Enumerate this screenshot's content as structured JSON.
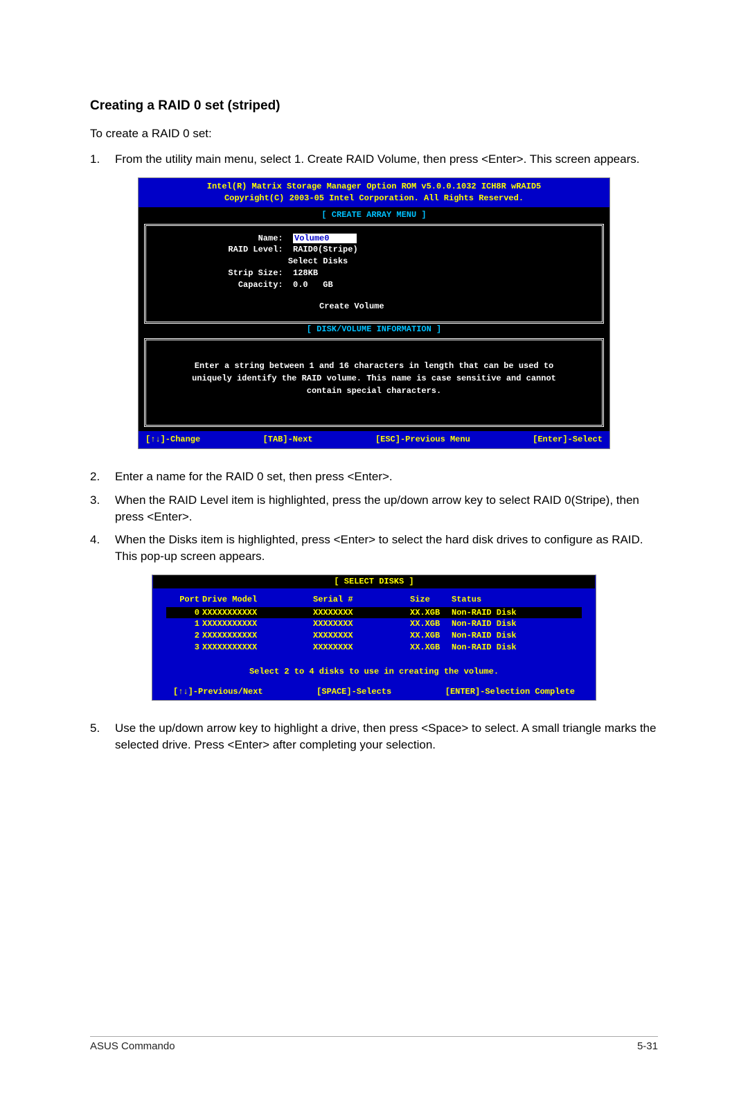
{
  "heading": "Creating a RAID 0 set (striped)",
  "intro": "To create a RAID 0 set:",
  "steps": {
    "s1": {
      "num": "1.",
      "text": "From the utility main menu, select 1. Create RAID Volume, then press <Enter>. This screen appears."
    },
    "s2": {
      "num": "2.",
      "text": "Enter a name for the RAID 0 set, then press <Enter>."
    },
    "s3": {
      "num": "3.",
      "text": "When the RAID Level item is highlighted, press the up/down arrow key to select RAID 0(Stripe), then press <Enter>."
    },
    "s4": {
      "num": "4.",
      "text": "When the Disks item is highlighted, press <Enter> to select the hard disk drives to configure as RAID. This pop-up screen appears."
    },
    "s5": {
      "num": "5.",
      "text": "Use the up/down arrow key to highlight a drive, then press <Space>  to select. A small triangle marks the selected drive. Press <Enter> after completing your selection."
    }
  },
  "bios1": {
    "header_line1": "Intel(R) Matrix Storage Manager Option ROM v5.0.0.1032 ICH8R wRAID5",
    "header_line2": "Copyright(C) 2003-05 Intel Corporation. All Rights Reserved.",
    "menu_title": "[ CREATE ARRAY MENU ]",
    "fields": {
      "name_label": "Name:",
      "name_value": "Volume0",
      "raid_label": "RAID Level:",
      "raid_value": "RAID0(Stripe)",
      "select_disks": "Select Disks",
      "strip_label": "Strip Size:",
      "strip_value": "128KB",
      "capacity_label": "Capacity:",
      "capacity_value": "0.0   GB"
    },
    "create_volume": "Create Volume",
    "info_title": "[ DISK/VOLUME INFORMATION ]",
    "info_text": "Enter a string between 1 and 16 characters in length that can be used to uniquely identify the RAID volume. This name is case sensitive and cannot contain special characters.",
    "footer": {
      "a": "[↑↓]-Change",
      "b": "[TAB]-Next",
      "c": "[ESC]-Previous Menu",
      "d": "[Enter]-Select"
    }
  },
  "bios2": {
    "title": "[ SELECT DISKS ]",
    "headers": {
      "port": "Port",
      "model": "Drive Model",
      "serial": "Serial #",
      "size": "Size",
      "status": "Status"
    },
    "rows": [
      {
        "port": "0",
        "model": "XXXXXXXXXXX",
        "serial": "XXXXXXXX",
        "size": "XX.XGB",
        "status": "Non-RAID Disk"
      },
      {
        "port": "1",
        "model": "XXXXXXXXXXX",
        "serial": "XXXXXXXX",
        "size": "XX.XGB",
        "status": "Non-RAID Disk"
      },
      {
        "port": "2",
        "model": "XXXXXXXXXXX",
        "serial": "XXXXXXXX",
        "size": "XX.XGB",
        "status": "Non-RAID Disk"
      },
      {
        "port": "3",
        "model": "XXXXXXXXXXX",
        "serial": "XXXXXXXX",
        "size": "XX.XGB",
        "status": "Non-RAID Disk"
      }
    ],
    "instruction": "Select 2 to 4 disks to use in creating the volume.",
    "footer": {
      "a": "[↑↓]-Previous/Next",
      "b": "[SPACE]-Selects",
      "c": "[ENTER]-Selection Complete"
    }
  },
  "pagefoot": {
    "left": "ASUS Commando",
    "right": "5-31"
  }
}
